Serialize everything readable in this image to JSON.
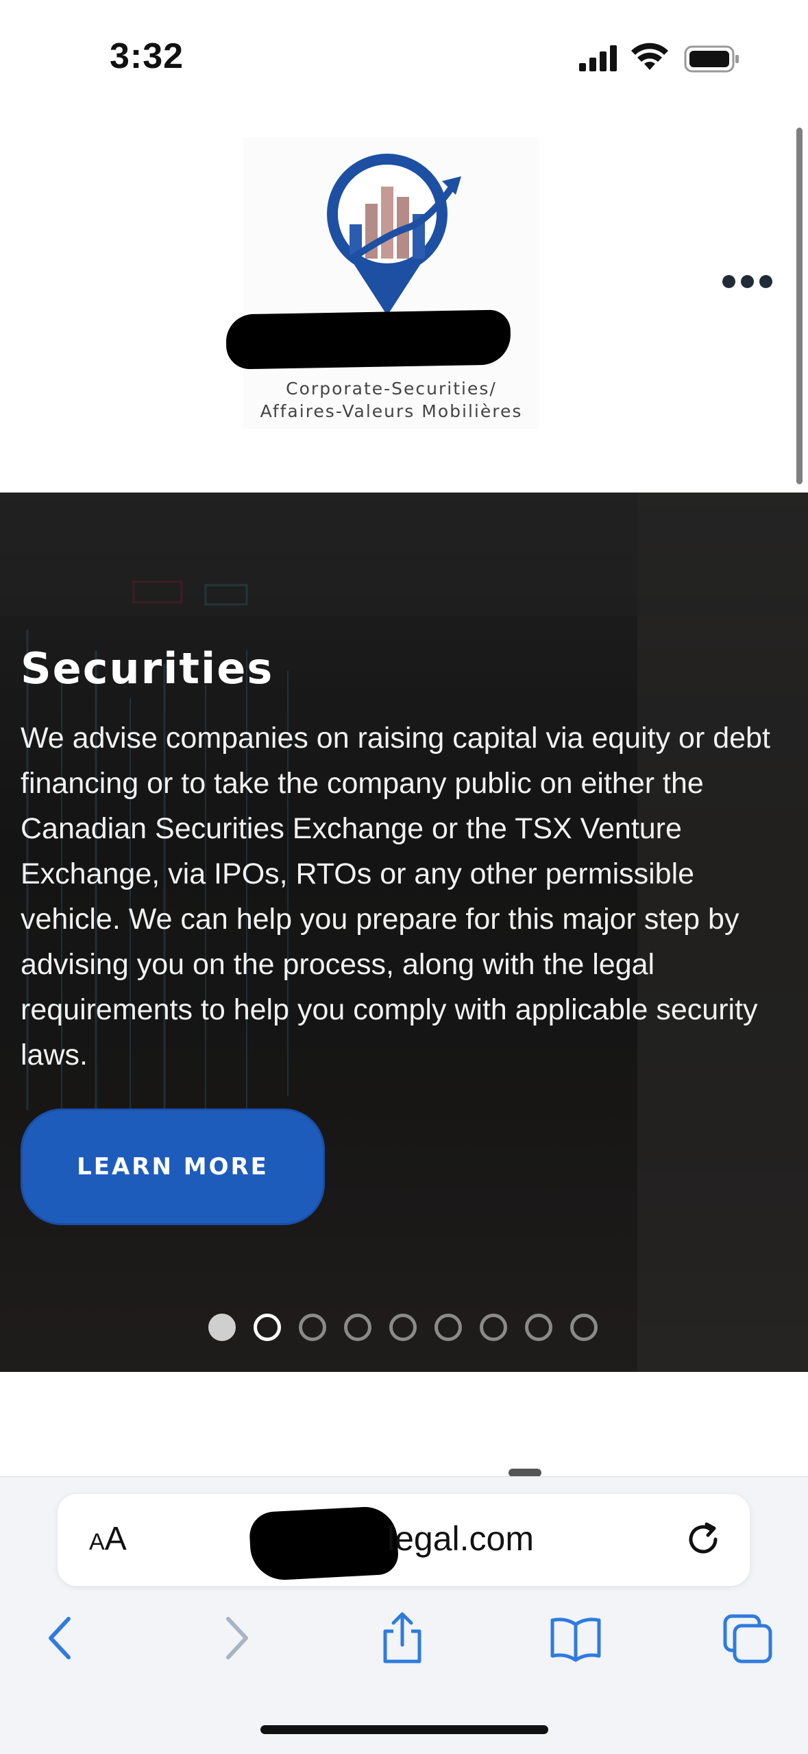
{
  "status_bar": {
    "time": "3:32"
  },
  "header": {
    "logo_lines": [
      "Corporate-Securities/",
      "Affaires-Valeurs Mobilières"
    ]
  },
  "hero": {
    "title": "Securities",
    "description": "We advise companies on raising capital via equity or debt financing or to take the company public on either the Canadian Securities Exchange or the TSX Venture Exchange, via IPOs, RTOs or any other permissible vehicle. We can help you prepare for this major step by advising you on the process, along with the legal requirements to help you comply with applicable security laws.",
    "button_label": "LEARN MORE",
    "slide_count": 9,
    "active_slide": 2
  },
  "browser": {
    "text_size_label_small": "A",
    "text_size_label_large": "A",
    "url_visible": "legal.com",
    "icons": [
      "back-icon",
      "forward-icon",
      "share-icon",
      "bookmarks-icon",
      "tabs-icon",
      "reload-icon"
    ]
  },
  "colors": {
    "accent_button": "#1e5cbc",
    "hero_dark": "#1b1b1b",
    "toolbar_blue": "#2f7be0"
  }
}
